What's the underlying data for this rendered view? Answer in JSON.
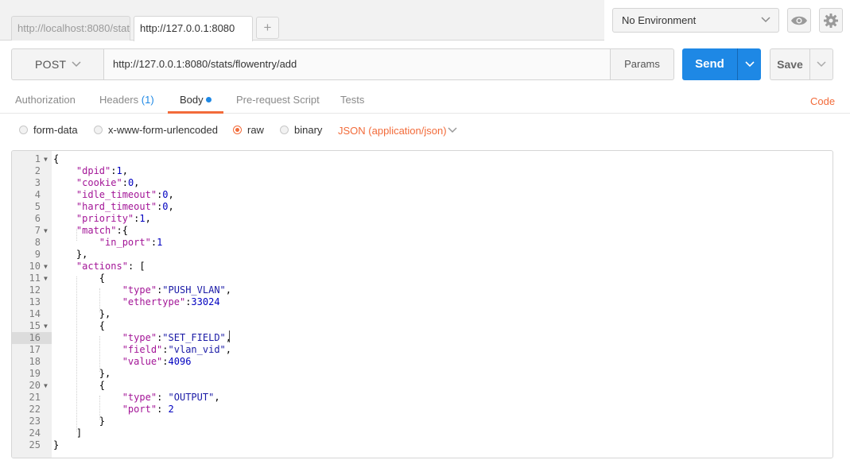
{
  "tabs": [
    {
      "label": "http://localhost:8080/stat"
    },
    {
      "label": "http://127.0.0.1:8080"
    }
  ],
  "tab_add": "+",
  "environment": {
    "selected": "No Environment"
  },
  "request": {
    "method": "POST",
    "url": "http://127.0.0.1:8080/stats/flowentry/add",
    "params_label": "Params",
    "send_label": "Send",
    "save_label": "Save"
  },
  "req_tabs": {
    "authorization": "Authorization",
    "headers": "Headers",
    "headers_count": "(1)",
    "body": "Body",
    "pre_request": "Pre-request Script",
    "tests": "Tests",
    "code": "Code"
  },
  "body_modes": {
    "form_data": "form-data",
    "urlencoded": "x-www-form-urlencoded",
    "raw": "raw",
    "binary": "binary",
    "selected": "raw",
    "content_type": "JSON (application/json)"
  },
  "editor": {
    "active_line": 16,
    "lines": [
      {
        "n": "1",
        "fold": true
      },
      {
        "n": "2"
      },
      {
        "n": "3"
      },
      {
        "n": "4"
      },
      {
        "n": "5"
      },
      {
        "n": "6"
      },
      {
        "n": "7",
        "fold": true
      },
      {
        "n": "8"
      },
      {
        "n": "9"
      },
      {
        "n": "10",
        "fold": true
      },
      {
        "n": "11",
        "fold": true
      },
      {
        "n": "12"
      },
      {
        "n": "13"
      },
      {
        "n": "14"
      },
      {
        "n": "15",
        "fold": true
      },
      {
        "n": "16"
      },
      {
        "n": "17"
      },
      {
        "n": "18"
      },
      {
        "n": "19"
      },
      {
        "n": "20",
        "fold": true
      },
      {
        "n": "21"
      },
      {
        "n": "22"
      },
      {
        "n": "23"
      },
      {
        "n": "24"
      },
      {
        "n": "25"
      }
    ]
  },
  "code": {
    "l1": "{",
    "l2_key": "\"dpid\"",
    "l2_val": "1",
    "l3_key": "\"cookie\"",
    "l3_val": "0",
    "l4_key": "\"idle_timeout\"",
    "l4_val": "0",
    "l5_key": "\"hard_timeout\"",
    "l5_val": "0",
    "l6_key": "\"priority\"",
    "l6_val": "1",
    "l7_key": "\"match\"",
    "l8_key": "\"in_port\"",
    "l8_val": "1",
    "l9": "},",
    "l10_key": "\"actions\"",
    "l11": "{",
    "l12_key": "\"type\"",
    "l12_val": "\"PUSH_VLAN\"",
    "l13_key": "\"ethertype\"",
    "l13_val": "33024",
    "l14": "},",
    "l15": "{",
    "l16_key": "\"type\"",
    "l16_val": "\"SET_FIELD\"",
    "l17_key": "\"field\"",
    "l17_val": "\"vlan_vid\"",
    "l18_key": "\"value\"",
    "l18_val": "4096",
    "l19": "},",
    "l20": "{",
    "l21_key": "\"type\"",
    "l21_val": "\"OUTPUT\"",
    "l22_key": "\"port\"",
    "l22_val": "2",
    "l23": "}",
    "l24": "]",
    "l25": "}"
  }
}
